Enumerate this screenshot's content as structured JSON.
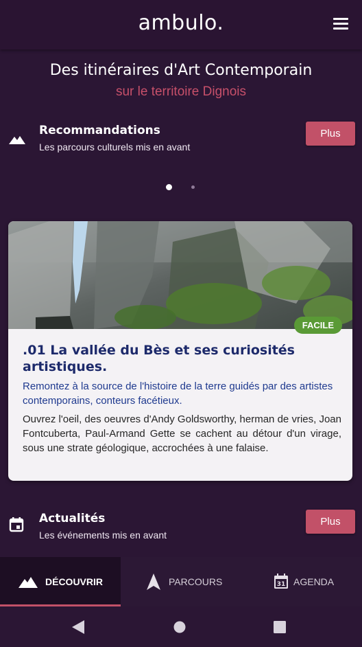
{
  "app": {
    "logo": "ambulo.",
    "menu_icon": "hamburger-menu-icon"
  },
  "hero": {
    "title": "Des itinéraires d'Art Contemporain",
    "subtitle": "sur le territoire Dignois"
  },
  "recommendations": {
    "icon": "mountain-icon",
    "title": "Recommandations",
    "subtitle": "Les parcours culturels mis en avant",
    "more_label": "Plus",
    "carousel": {
      "page_count": 2,
      "active_page": 1
    }
  },
  "card": {
    "badge": "FACILE",
    "title": ".01 La vallée du Bès et ses curiosités artistiques.",
    "lead": "Remontez à la source de l'histoire de la terre guidés par des artistes contemporains, conteurs facétieux.",
    "body": "Ouvrez l'oeil, des oeuvres d'Andy Goldsworthy, herman de vries, Joan Fontcuberta, Paul-Armand Gette se cachent au détour d'un virage, sous une strate géologique, accrochées à une falaise."
  },
  "news": {
    "icon": "calendar-icon",
    "title": "Actualités",
    "subtitle": "Les événements mis en avant",
    "more_label": "Plus"
  },
  "nav": {
    "items": [
      {
        "label": "DÉCOUVRIR",
        "icon": "mountain-icon",
        "active": true
      },
      {
        "label": "PARCOURS",
        "icon": "navigation-arrow-icon",
        "active": false
      },
      {
        "label": "AGENDA",
        "icon": "calendar-31-icon",
        "icon_text": "31",
        "active": false
      }
    ]
  },
  "colors": {
    "background": "#2b1634",
    "accent": "#c25168",
    "badge": "#5a9a36",
    "title_blue": "#1d2a6b"
  }
}
